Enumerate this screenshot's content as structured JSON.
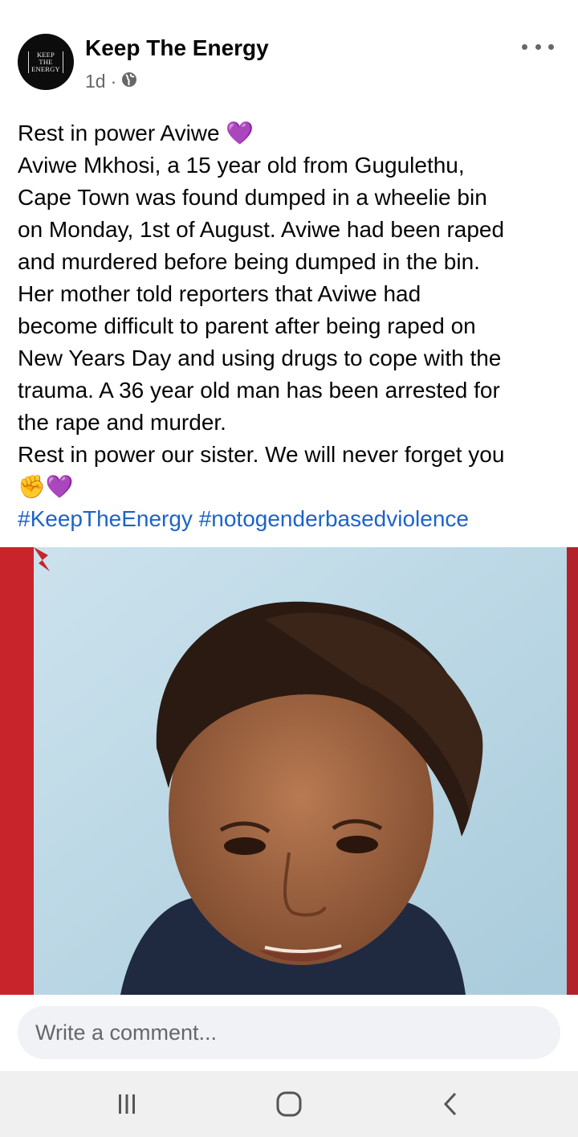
{
  "post": {
    "page_name": "Keep The Energy",
    "avatar_logo_text": [
      "KEEP",
      "THE",
      "ENERGY"
    ],
    "time": "1d",
    "separator": "·",
    "audience_icon": "globe-icon",
    "more_icon": "more-horizontal-icon",
    "lines": [
      "Rest in power Aviwe",
      "Aviwe Mkhosi, a 15 year old from Gugulethu,",
      "Cape Town was found dumped in a wheelie bin",
      "on Monday, 1st of August. Aviwe had been raped",
      "and murdered before being dumped in the bin.",
      "Her mother told reporters that Aviwe had",
      "become difficult to parent after being raped on",
      "New Years Day and using drugs to cope with the",
      "trauma. A 36 year old man has been arrested for",
      "the rape and murder.",
      "Rest in power our sister. We will never forget you"
    ],
    "emojis": {
      "purple_heart": "💜",
      "raised_fist": "✊"
    },
    "hashtags": "#KeepTheEnergy #notogenderbasedviolence"
  },
  "comment": {
    "placeholder": "Write a comment..."
  },
  "nav": {
    "recents_icon": "recents-icon",
    "home_icon": "home-icon",
    "back_icon": "back-icon"
  },
  "colors": {
    "hashtag": "#1d63c9",
    "secondary_text": "#65676b",
    "comment_bg": "#f0f2f5",
    "nav_bg": "#f0f0f0"
  }
}
